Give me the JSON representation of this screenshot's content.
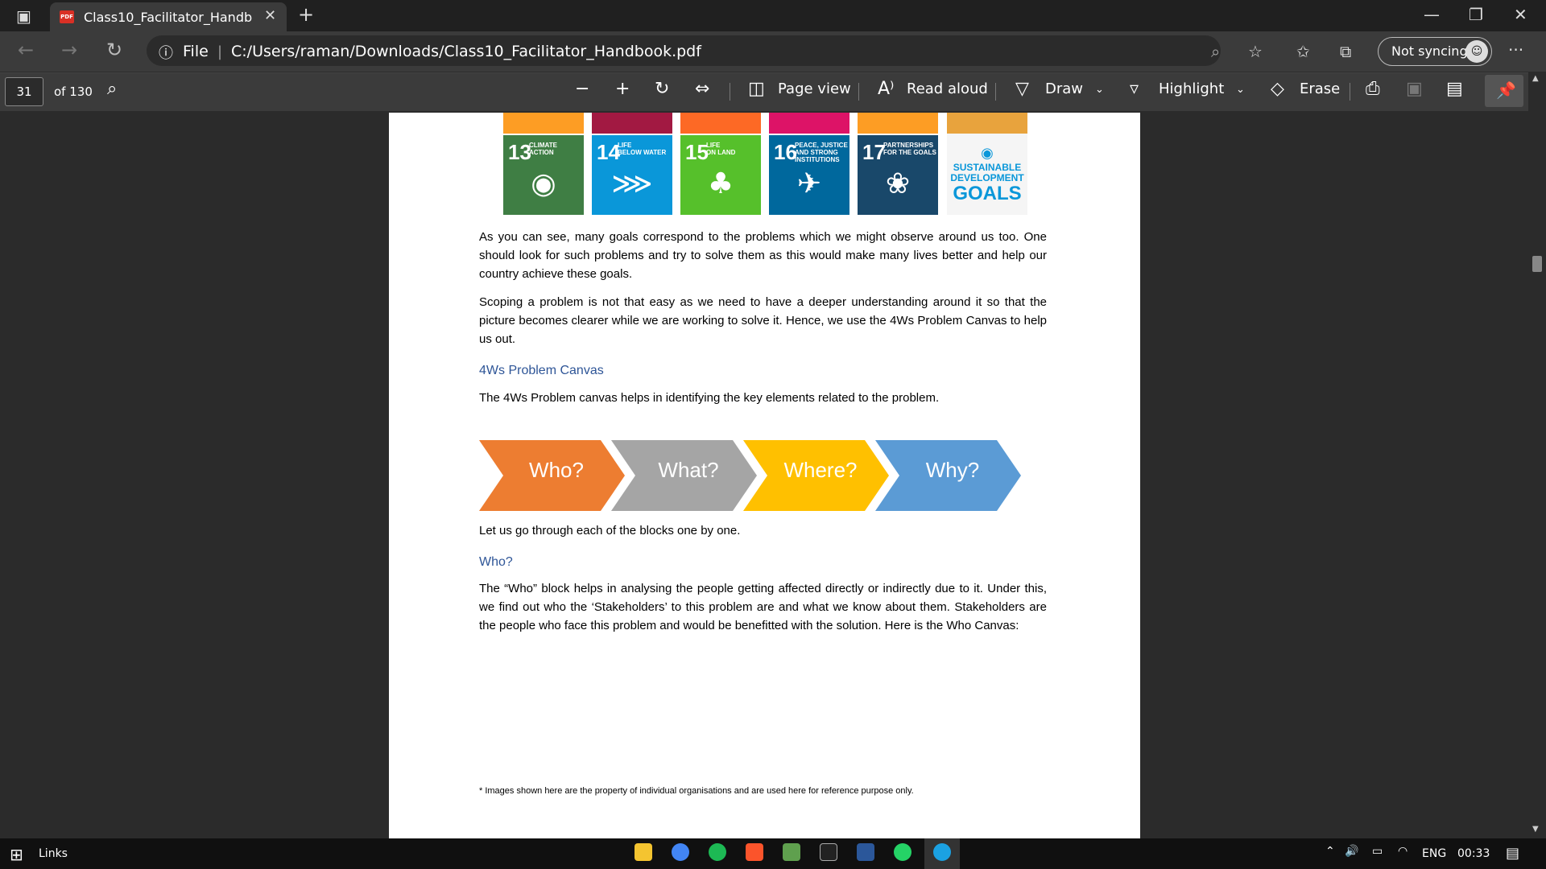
{
  "browser": {
    "tab_title": "Class10_Facilitator_Handbook.pd",
    "tab_icon": "PDF",
    "address_prefix": "File",
    "url": "C:/Users/raman/Downloads/Class10_Facilitator_Handbook.pdf",
    "sync_label": "Not syncing"
  },
  "pdf_toolbar": {
    "page_number": "31",
    "page_total": "of 130",
    "page_view": "Page view",
    "read_aloud": "Read aloud",
    "draw": "Draw",
    "highlight": "Highlight",
    "erase": "Erase"
  },
  "sdg_tiles": [
    {
      "num": "13",
      "label": "CLIMATE\nACTION",
      "color": "#3f7e44",
      "top_color": "#fd9d24",
      "icon": "earth-eye-icon"
    },
    {
      "num": "14",
      "label": "LIFE\nBELOW WATER",
      "color": "#0a97d9",
      "top_color": "#a21942",
      "icon": "fish-icon"
    },
    {
      "num": "15",
      "label": "LIFE\nON LAND",
      "color": "#56c02b",
      "top_color": "#fd6925",
      "icon": "tree-icon"
    },
    {
      "num": "16",
      "label": "PEACE, JUSTICE\nAND STRONG\nINSTITUTIONS",
      "color": "#00689d",
      "top_color": "#dd1367",
      "icon": "dove-icon"
    },
    {
      "num": "17",
      "label": "PARTNERSHIPS\nFOR THE GOALS",
      "color": "#19486a",
      "top_color": "#fd9d24",
      "icon": "rings-icon"
    }
  ],
  "sdg_logo": {
    "line1": "SUSTAINABLE",
    "line2": "DEVELOPMENT",
    "line3": "GOALS"
  },
  "content": {
    "p1": "As you can see, many goals correspond to the problems which we might observe around us too. One should look for such problems and try to solve them as this would make many lives better and help our country achieve these goals.",
    "p2": "Scoping a problem is not that easy as we need to have a deeper understanding around it so that the picture becomes clearer while we are working to solve it. Hence, we use the 4Ws Problem Canvas to help us out.",
    "h1": "4Ws Problem Canvas",
    "p3": "The 4Ws Problem canvas helps in identifying the key elements related to the problem.",
    "p4": "Let us go through each of the blocks one by one.",
    "h2": "Who?",
    "p5": "The “Who” block helps in analysing the people getting affected directly or indirectly due to it. Under this, we find out who the ‘Stakeholders’ to this problem are and what we know about them. Stakeholders are the people who face this problem and would be benefitted with the solution. Here is the Who Canvas:",
    "footnote": "* Images shown here are the property of individual organisations and are used here for reference purpose only."
  },
  "arrows": [
    {
      "label": "Who?",
      "color": "#ed7d31"
    },
    {
      "label": "What?",
      "color": "#a5a5a5"
    },
    {
      "label": "Where?",
      "color": "#ffc000"
    },
    {
      "label": "Why?",
      "color": "#5b9bd5"
    }
  ],
  "taskbar": {
    "links": "Links",
    "lang": "ENG",
    "time": "00:33"
  }
}
